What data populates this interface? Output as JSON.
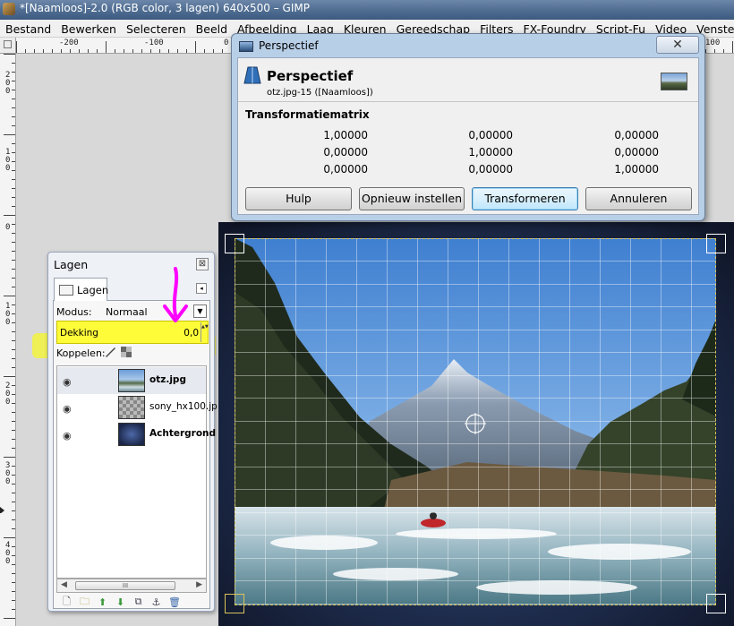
{
  "window": {
    "title": "*[Naamloos]-2.0 (RGB color, 3 lagen) 640x500 – GIMP"
  },
  "menu": [
    "Bestand",
    "Bewerken",
    "Selecteren",
    "Beeld",
    "Afbeelding",
    "Laag",
    "Kleuren",
    "Gereedschap",
    "Filters",
    "FX-Foundry",
    "Script-Fu",
    "Video",
    "Vensters"
  ],
  "rulers": {
    "h_labels": [
      "-200",
      "-100",
      "0",
      "100"
    ],
    "v_labels": [
      "200",
      "100",
      "0",
      "100",
      "200",
      "300",
      "400"
    ]
  },
  "dialog": {
    "window_title": "Perspectief",
    "close_glyph": "✕",
    "heading": "Perspectief",
    "subheading": "otz.jpg-15 ([Naamloos])",
    "matrix_title": "Transformatiematrix",
    "matrix": [
      [
        "1,00000",
        "0,00000",
        "0,00000"
      ],
      [
        "0,00000",
        "1,00000",
        "0,00000"
      ],
      [
        "0,00000",
        "0,00000",
        "1,00000"
      ]
    ],
    "buttons": {
      "help": "Hulp",
      "reset": "Opnieuw instellen",
      "transform": "Transformeren",
      "cancel": "Annuleren"
    }
  },
  "layers_panel": {
    "title": "Lagen",
    "close_glyph": "⊠",
    "tab_label": "Lagen",
    "tab_menu_glyph": "◂",
    "mode_label": "Modus:",
    "mode_value": "Normaal",
    "mode_dropdown_glyph": "▼",
    "opacity_label": "Dekking",
    "opacity_value": "0,0",
    "opacity_spin_glyph": "▲▼",
    "link_label": "Koppelen:",
    "eye_glyph": "◉",
    "layers": [
      {
        "name": "otz.jpg",
        "selected": true,
        "bold": true
      },
      {
        "name": "sony_hx100.jp",
        "selected": false,
        "bold": false
      },
      {
        "name": "Achtergrond",
        "selected": false,
        "bold": true
      }
    ],
    "scroll": {
      "left": "◀",
      "right": "▶",
      "grip": "III"
    },
    "toolbar_icons": [
      "new-layer-icon",
      "layer-group-icon",
      "raise-layer-icon",
      "lower-layer-icon",
      "duplicate-layer-icon",
      "anchor-layer-icon",
      "delete-layer-icon"
    ],
    "toolbar_glyphs": [
      "🗋",
      "🗀",
      "⬆",
      "⬇",
      "⧉",
      "⚓",
      "🗑"
    ]
  },
  "annotation": {
    "color": "#ff00ff",
    "highlight_color": "#ffff00"
  }
}
